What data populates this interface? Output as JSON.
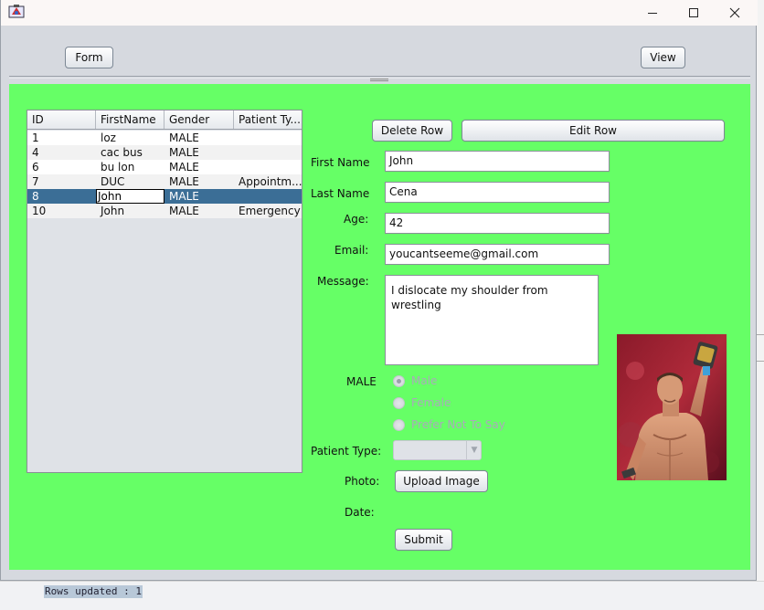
{
  "window": {
    "icon": "java-app-icon"
  },
  "caption": {
    "minimize": "─",
    "maximize": "☐",
    "close": "✕"
  },
  "toolbar": {
    "form_label": "Form",
    "view_label": "View"
  },
  "table": {
    "columns": [
      "ID",
      "FirstName",
      "Gender",
      "Patient Ty..."
    ],
    "rows": [
      {
        "id": "1",
        "first_name": "loz",
        "gender": "MALE",
        "patient_type": ""
      },
      {
        "id": "4",
        "first_name": "cac bus",
        "gender": "MALE",
        "patient_type": ""
      },
      {
        "id": "6",
        "first_name": "bu lon",
        "gender": "MALE",
        "patient_type": ""
      },
      {
        "id": "7",
        "first_name": "DUC",
        "gender": "MALE",
        "patient_type": "Appointm..."
      },
      {
        "id": "8",
        "first_name": "John",
        "gender": "MALE",
        "patient_type": ""
      },
      {
        "id": "10",
        "first_name": "John",
        "gender": "MALE",
        "patient_type": "Emergency"
      }
    ],
    "selected_row": 4
  },
  "actions": {
    "delete_label": "Delete Row",
    "edit_label": "Edit Row"
  },
  "form": {
    "first_name_label": "First Name",
    "first_name_value": "John",
    "last_name_label": "Last Name",
    "last_name_value": "Cena",
    "age_label": "Age:",
    "age_value": "42",
    "email_label": "Email:",
    "email_value": "youcantseeme@gmail.com",
    "message_label": "Message:",
    "message_value": "I dislocate my shoulder from wrestling",
    "gender_label": "MALE",
    "gender_options": [
      "Male",
      "Female",
      "Prefer Not To Say"
    ],
    "gender_selected": "Male",
    "patient_type_label": "Patient Type:",
    "patient_type_value": "",
    "photo_label": "Photo:",
    "upload_label": "Upload Image",
    "date_label": "Date:",
    "submit_label": "Submit"
  },
  "console": {
    "text": "Rows updated : 1"
  },
  "colors": {
    "panel": "#66ff66",
    "selection": "#3b6e96"
  }
}
